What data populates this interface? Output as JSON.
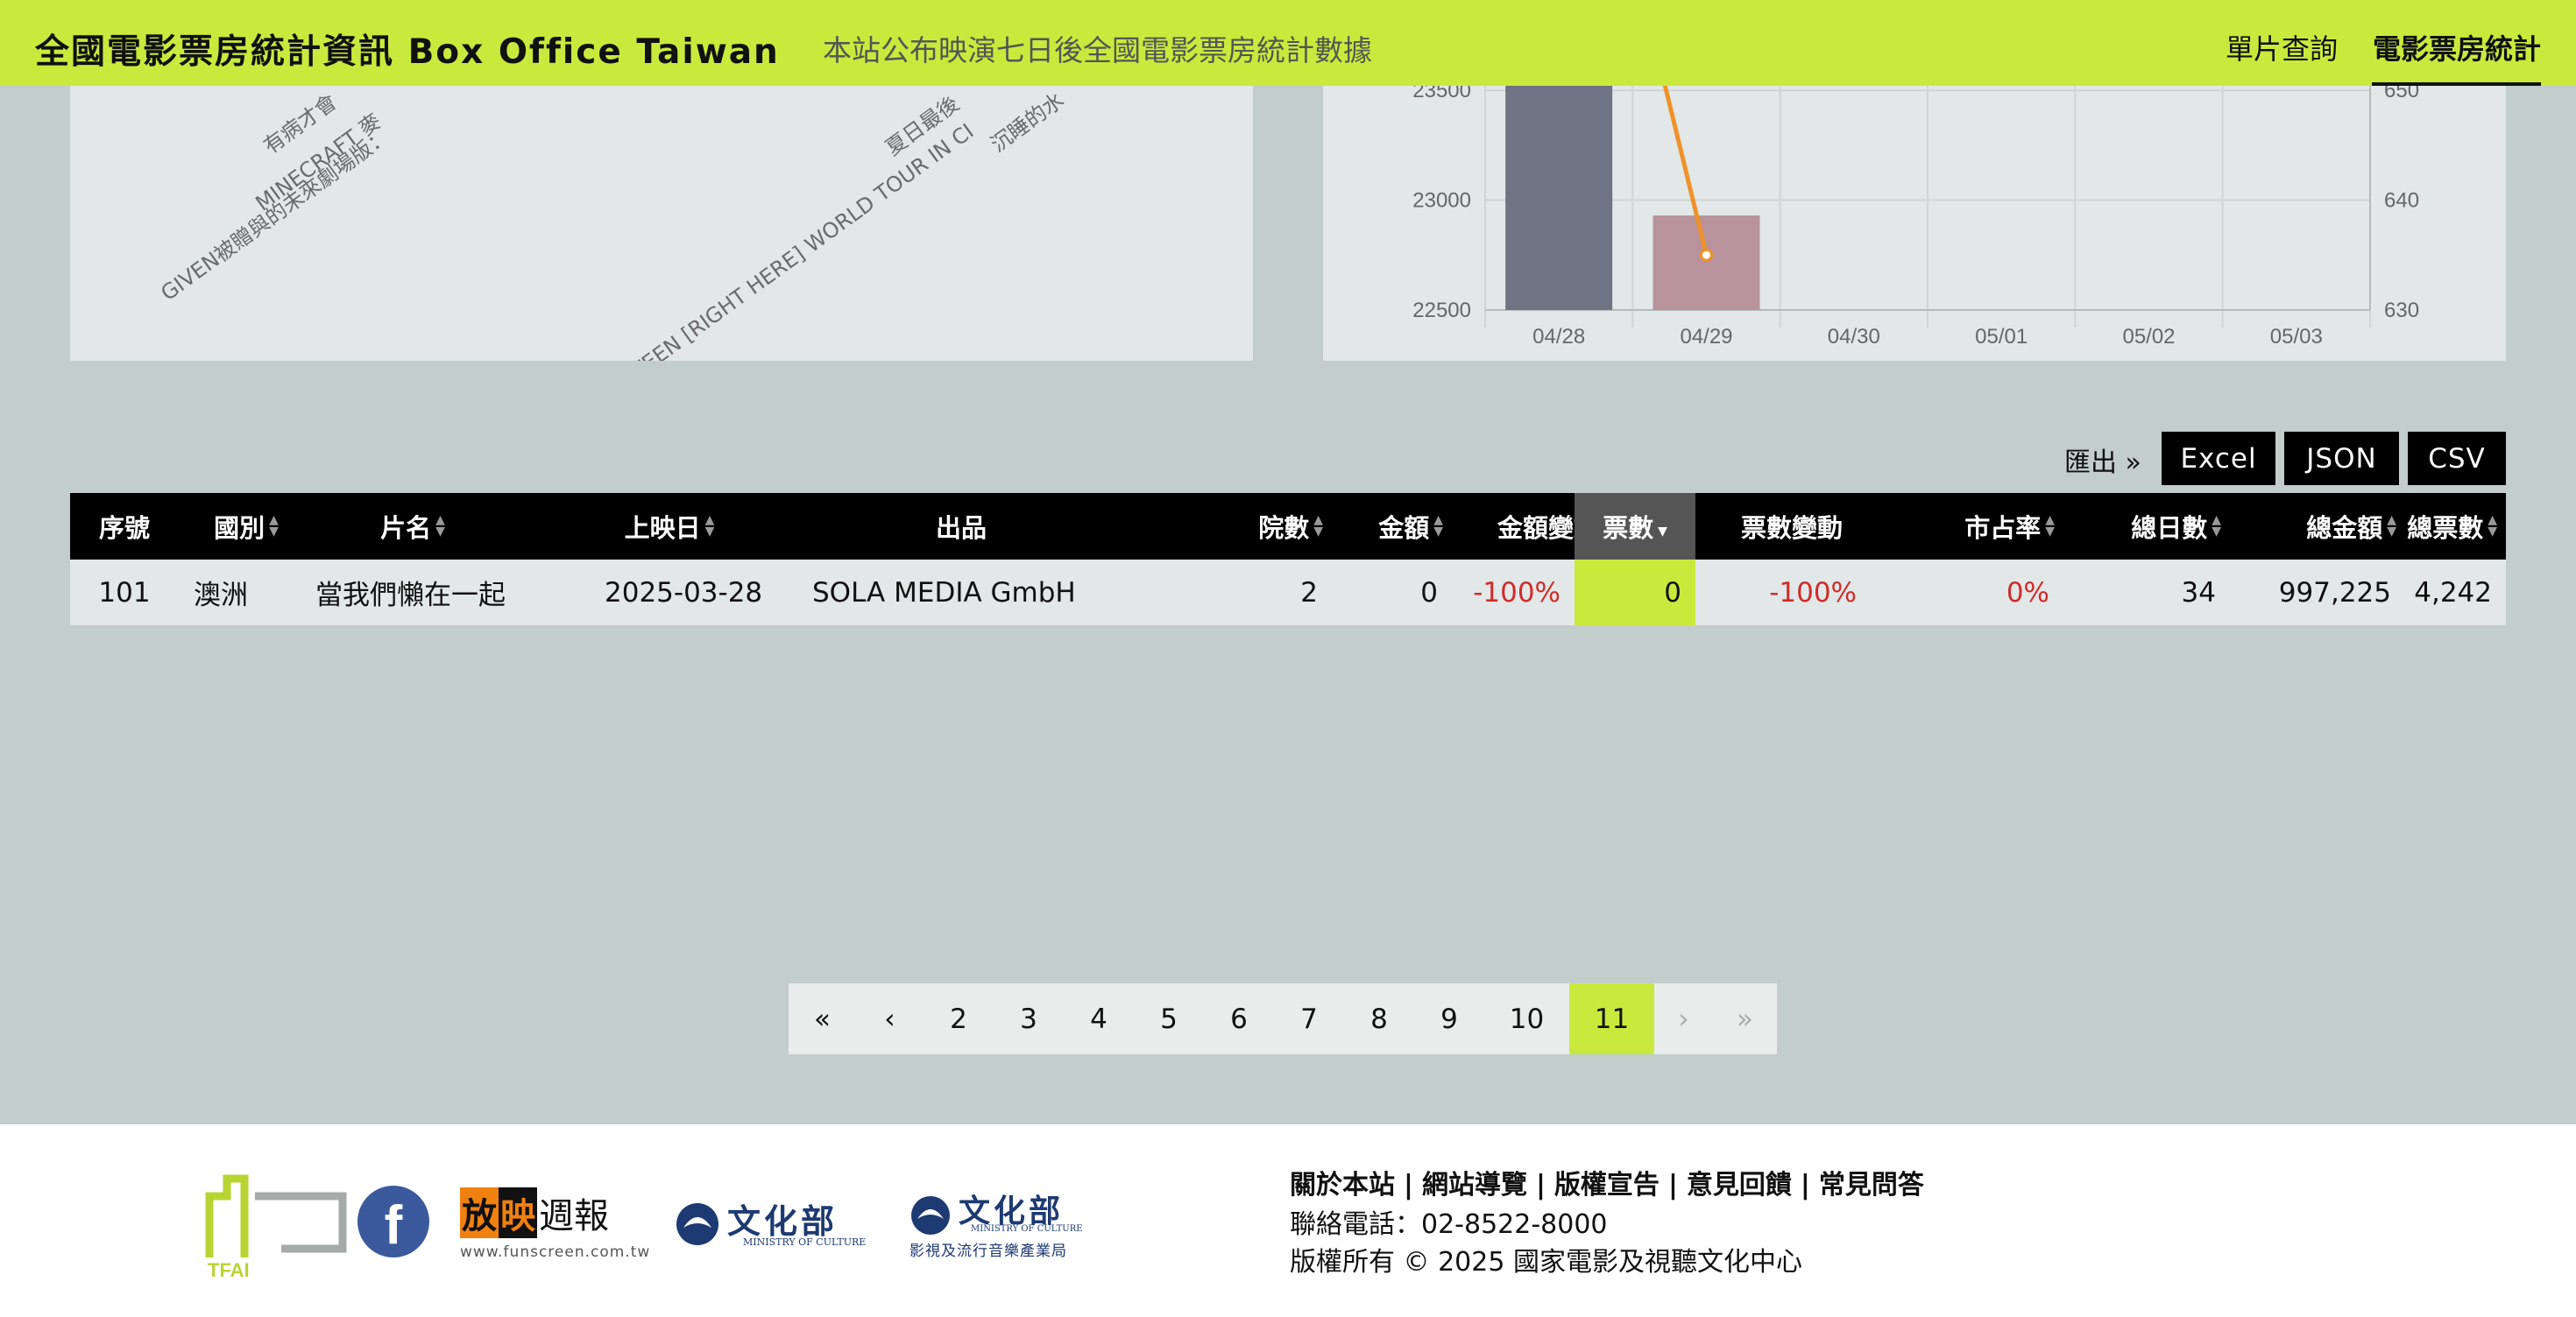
{
  "header": {
    "title": "全國電影票房統計資訊 Box Office Taiwan",
    "subtitle": "本站公布映演七日後全國電影票房統計數據",
    "nav": [
      "單片查詢",
      "電影票房統計"
    ]
  },
  "left_chart": {
    "labels": [
      "有病才會",
      "MINECRAFT 麥",
      "GIVEN被贈與的未來劇場版：",
      "SEVENTEEN [RIGHT HERE] WORLD TOUR IN CI",
      "夏日最後",
      "沉睡的水"
    ]
  },
  "right_chart": {
    "y_left_ticks": [
      "23500",
      "23000",
      "22500"
    ],
    "y_right_ticks": [
      "650",
      "640",
      "630"
    ],
    "x_ticks": [
      "04/28",
      "04/29",
      "04/30",
      "05/01",
      "05/02",
      "05/03"
    ]
  },
  "chart_data": {
    "type": "bar",
    "categories": [
      "04/28",
      "04/29",
      "04/30",
      "05/01",
      "05/02",
      "05/03"
    ],
    "series": [
      {
        "values": [
          23600,
          22930,
          null,
          null,
          null,
          null
        ],
        "colors": [
          "#6e7483",
          "#b8939b"
        ]
      },
      {
        "type": "line",
        "values": [
          690,
          635,
          null,
          null,
          null,
          null
        ],
        "color": "#f0912a"
      }
    ],
    "ylim": [
      22500,
      23600
    ],
    "ylim_right": [
      630,
      652
    ]
  },
  "export": {
    "label": "匯出 »",
    "buttons": [
      "Excel",
      "JSON",
      "CSV"
    ]
  },
  "table": {
    "headers": [
      "序號",
      "國別",
      "片名",
      "上映日",
      "出品",
      "院數",
      "金額",
      "金額變動",
      "票數",
      "票數變動",
      "市占率",
      "總日數",
      "總金額",
      "總票數"
    ],
    "row": {
      "no": "101",
      "country": "澳洲",
      "title": "當我們懶在一起",
      "release": "2025-03-28",
      "distributor": "SOLA MEDIA GmbH",
      "theaters": "2",
      "amount": "0",
      "amount_change": "-100%",
      "tickets": "0",
      "tickets_change": "-100%",
      "share": "0%",
      "total_days": "34",
      "total_amount": "997,225",
      "total_tickets": "4,242"
    }
  },
  "pagination": {
    "first": "«",
    "prev": "‹",
    "pages": [
      "2",
      "3",
      "4",
      "5",
      "6",
      "7",
      "8",
      "9",
      "10",
      "11"
    ],
    "current": "11",
    "next": "›",
    "last": "»"
  },
  "footer": {
    "links": [
      "關於本站",
      "網站導覽",
      "版權宣告",
      "意見回饋",
      "常見問答"
    ],
    "phone": "聯絡電話：02-8522-8000",
    "copyright": "版權所有 © 2025 國家電影及視聽文化中心",
    "logos": {
      "tfai": "TFAI",
      "funscreen_a": "放",
      "funscreen_b": "映",
      "funscreen_c": "週報",
      "funscreen_url": "www.funscreen.com.tw",
      "moc": "文化部",
      "moc_en": "MINISTRY OF CULTURE",
      "bavpi": "文化部",
      "bavpi_en": "MINISTRY OF CULTURE",
      "bavpi_sub": "影視及流行音樂產業局"
    }
  },
  "colors": {
    "accent": "#c9ea3c",
    "negative": "#d12b2b",
    "bar1": "#6e7483",
    "bar2": "#b8939b",
    "line": "#f0912a"
  }
}
